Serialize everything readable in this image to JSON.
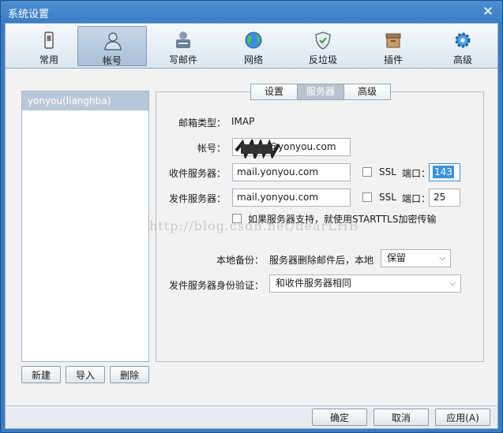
{
  "window": {
    "title": "系统设置"
  },
  "toolbar": {
    "items": [
      {
        "label": "常用",
        "icon": "phone-icon"
      },
      {
        "label": "帐号",
        "icon": "user-icon",
        "active": true
      },
      {
        "label": "写邮件",
        "icon": "compose-icon"
      },
      {
        "label": "网络",
        "icon": "globe-icon"
      },
      {
        "label": "反垃圾",
        "icon": "shield-icon"
      },
      {
        "label": "插件",
        "icon": "plugin-box-icon"
      },
      {
        "label": "高级",
        "icon": "gear-icon"
      }
    ]
  },
  "accounts": {
    "items": [
      "yonyou(lianghba)"
    ],
    "buttons": {
      "new": "新建",
      "import": "导入",
      "delete": "删除"
    }
  },
  "tabs": {
    "items": [
      "设置",
      "服务器",
      "高级"
    ],
    "active": "服务器"
  },
  "server": {
    "mailbox_type_label": "邮箱类型：",
    "mailbox_type_value": "IMAP",
    "account_label": "帐号：",
    "account_value": "@yonyou.com",
    "incoming_label": "收件服务器：",
    "incoming_value": "mail.yonyou.com",
    "outgoing_label": "发件服务器：",
    "outgoing_value": "mail.yonyou.com",
    "ssl_label": "SSL",
    "port_label": "端口：",
    "incoming_port": "143",
    "outgoing_port": "25",
    "starttls_label": "如果服务器支持，就使用STARTTLS加密传输",
    "backup_label": "本地备份：",
    "backup_desc": "服务器删除邮件后，本地",
    "backup_value": "保留",
    "auth_label": "发件服务器身份验证：",
    "auth_value": "和收件服务器相同"
  },
  "watermark": "http://blog.csdn.net/dearLHB",
  "footer": {
    "ok": "确定",
    "cancel": "取消",
    "apply": "应用(A)"
  },
  "colors": {
    "titlebar": "#3a7cc2",
    "selection": "#3a8fe0",
    "list_selected": "#b9c8d9"
  }
}
